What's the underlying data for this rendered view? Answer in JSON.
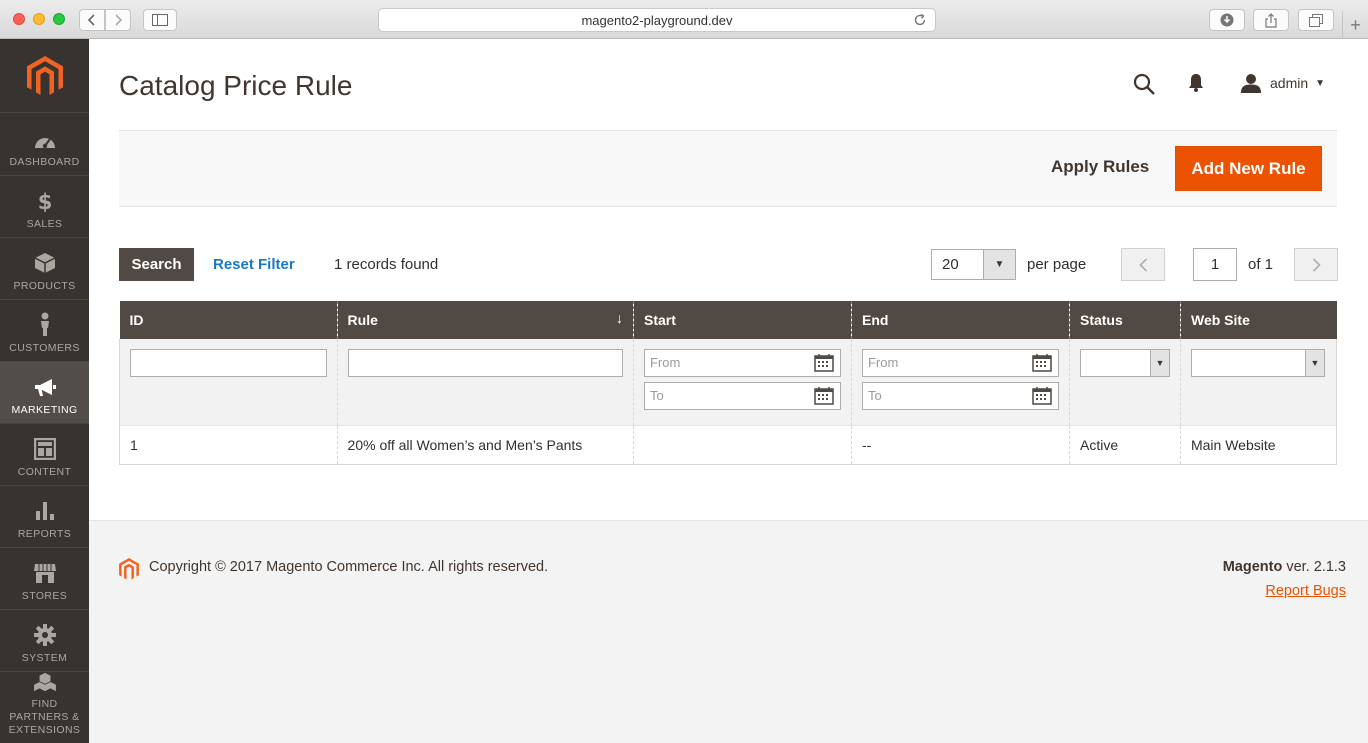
{
  "browser": {
    "url": "magento2-playground.dev"
  },
  "sidebar": {
    "items": [
      {
        "label": "DASHBOARD",
        "icon": "dashboard-icon"
      },
      {
        "label": "SALES",
        "icon": "dollar-icon"
      },
      {
        "label": "PRODUCTS",
        "icon": "box-icon"
      },
      {
        "label": "CUSTOMERS",
        "icon": "person-icon"
      },
      {
        "label": "MARKETING",
        "icon": "megaphone-icon",
        "active": true
      },
      {
        "label": "CONTENT",
        "icon": "layout-icon"
      },
      {
        "label": "REPORTS",
        "icon": "bar-chart-icon"
      },
      {
        "label": "STORES",
        "icon": "store-icon"
      },
      {
        "label": "SYSTEM",
        "icon": "gear-icon"
      },
      {
        "label": "FIND PARTNERS & EXTENSIONS",
        "icon": "boxes-icon"
      }
    ]
  },
  "header": {
    "title": "Catalog Price Rule",
    "user": "admin"
  },
  "actions": {
    "apply": "Apply Rules",
    "add": "Add New Rule"
  },
  "grid_tools": {
    "search": "Search",
    "reset": "Reset Filter",
    "records": "1 records found",
    "per_page_value": "20",
    "per_page_label": "per page",
    "page": "1",
    "of": "of 1"
  },
  "table": {
    "columns": [
      "ID",
      "Rule",
      "Start",
      "End",
      "Status",
      "Web Site"
    ],
    "filters": {
      "from": "From",
      "to": "To"
    },
    "rows": [
      [
        "1",
        "20% off all Women’s and Men’s Pants",
        "",
        "--",
        "Active",
        "Main Website"
      ]
    ]
  },
  "footer": {
    "copyright": "Copyright © 2017 Magento Commerce Inc. All rights reserved.",
    "brand": "Magento",
    "version": " ver. 2.1.3",
    "report": "Report Bugs"
  },
  "colors": {
    "accent": "#eb5202",
    "sidebar": "#373330",
    "header": "#514943",
    "link": "#1979c3"
  }
}
